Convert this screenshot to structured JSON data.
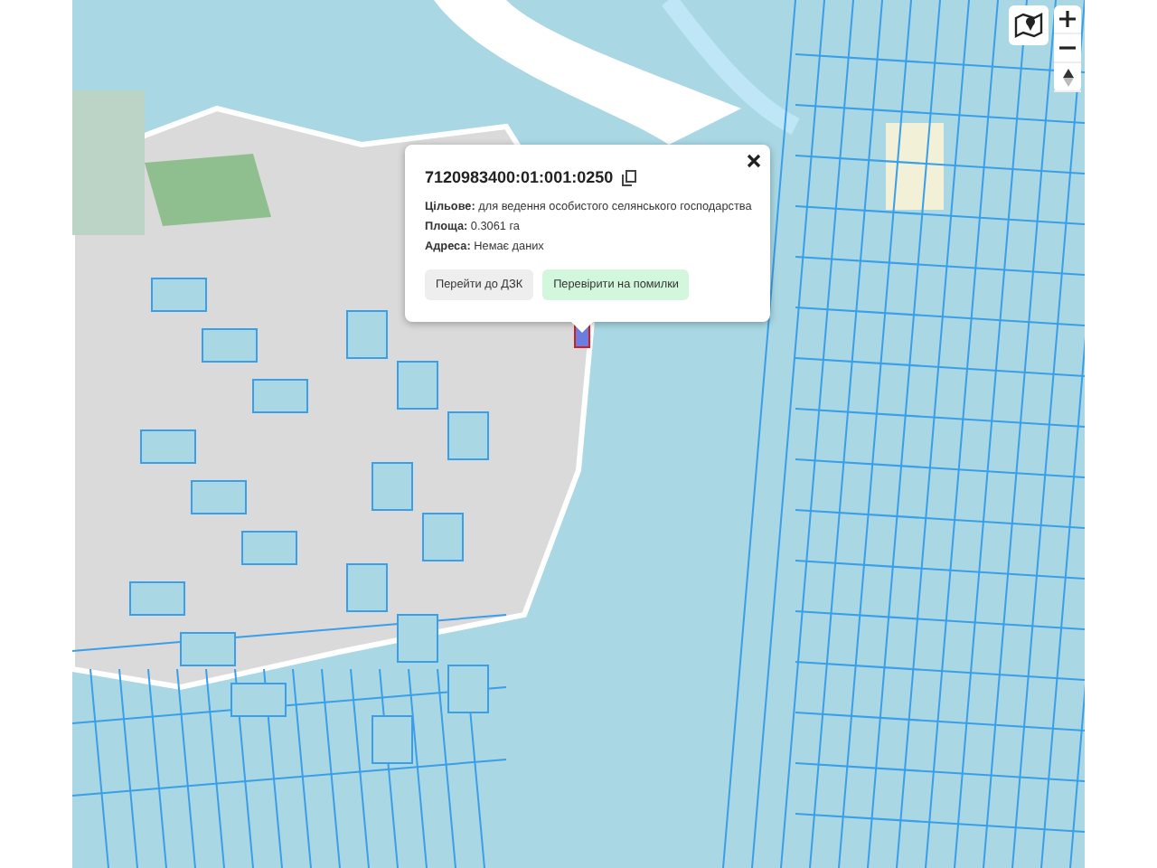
{
  "popup": {
    "title": "7120983400:01:001:0250",
    "fields": [
      "**Цільове:** для ведення особистого селянського господарства",
      "**Площа:** 0.3061 га",
      "**Адреса:** Немає даних"
    ],
    "buttons": [
      {
        "label": "Перейти до ДЗК",
        "kind": "secondary"
      },
      {
        "label": "Перевірити на помилки",
        "kind": "primary"
      }
    ]
  }
}
